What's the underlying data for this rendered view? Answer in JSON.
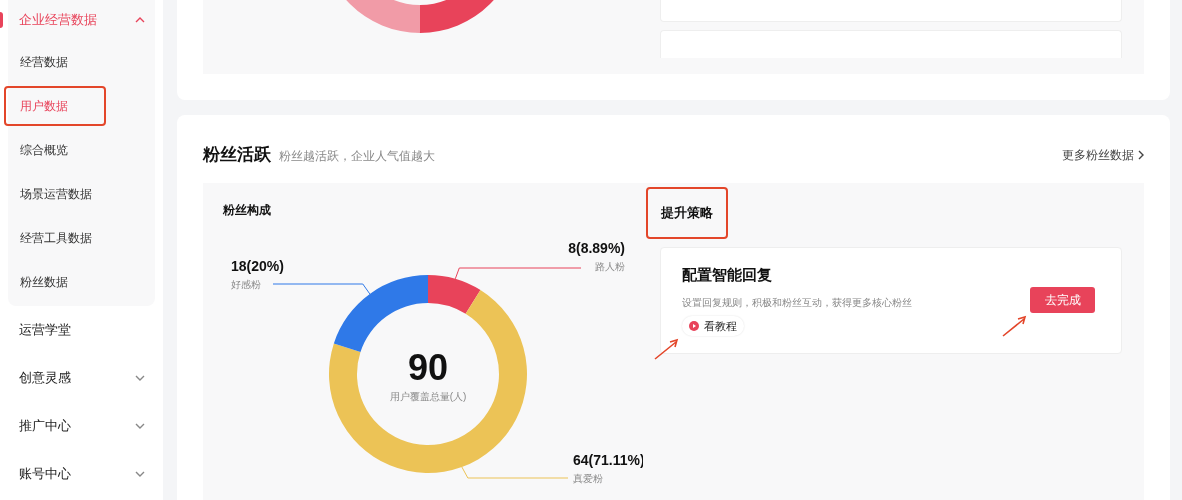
{
  "sidebar": {
    "items": [
      {
        "label": "企业经营数据",
        "expanded": true,
        "children": [
          {
            "label": "经营数据",
            "selected": false,
            "annotated": false
          },
          {
            "label": "用户数据",
            "selected": true,
            "annotated": true
          },
          {
            "label": "综合概览",
            "selected": false,
            "annotated": false
          },
          {
            "label": "场景运营数据",
            "selected": false,
            "annotated": false
          },
          {
            "label": "经营工具数据",
            "selected": false,
            "annotated": false
          },
          {
            "label": "粉丝数据",
            "selected": false,
            "annotated": false
          }
        ]
      },
      {
        "label": "运营学堂"
      },
      {
        "label": "创意灵感",
        "expanded": false
      },
      {
        "label": "推广中心",
        "expanded": false
      },
      {
        "label": "账号中心",
        "expanded": false
      }
    ]
  },
  "fans_section": {
    "title": "粉丝活跃",
    "subtitle": "粉丝越活跃，企业人气值越大",
    "more_link": "更多粉丝数据",
    "composition": {
      "title": "粉丝构成",
      "total": "90",
      "total_label": "用户覆盖总量(人)",
      "chart_data": {
        "type": "donut",
        "categories": [
          "路人粉",
          "真爱粉",
          "好感粉"
        ],
        "values": [
          8,
          64,
          18
        ],
        "colors": [
          "#e8435a",
          "#ecc356",
          "#2f79e8"
        ],
        "value_labels": [
          "8(8.89%)",
          "64(71.11%)",
          "18(20%)"
        ]
      }
    },
    "strategy": {
      "title": "提升策略",
      "annotated": true,
      "task": {
        "title": "配置智能回复",
        "description": "设置回复规则，积极和粉丝互动，获得更多核心粉丝",
        "tutorial": {
          "label": "看教程",
          "pointed": true
        },
        "action": {
          "label": "去完成",
          "pointed": true
        }
      }
    }
  }
}
